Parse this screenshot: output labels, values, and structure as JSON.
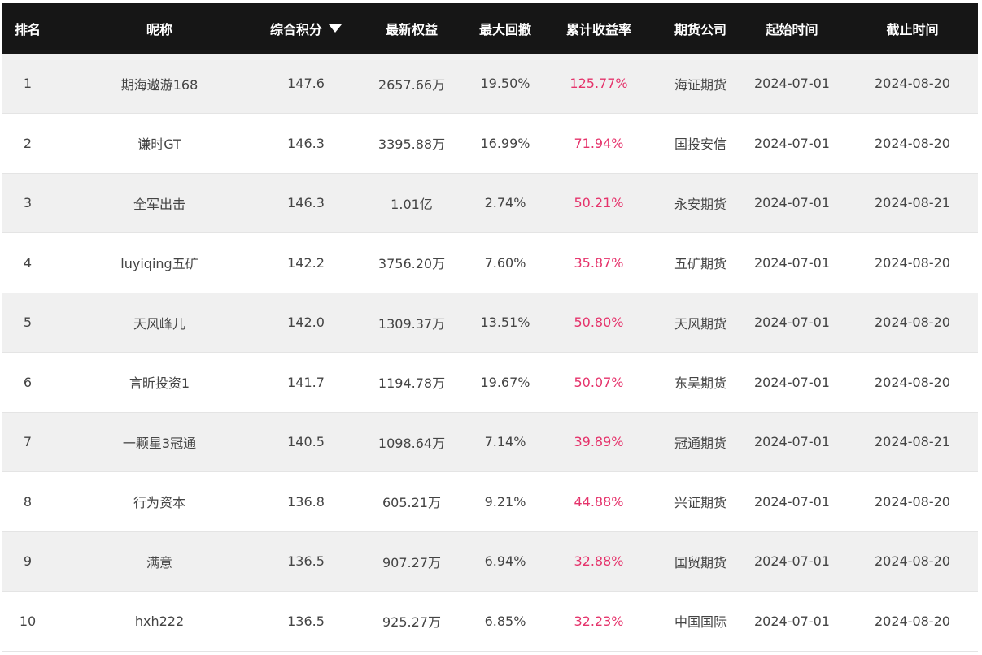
{
  "colors": {
    "header_bg": "#161616",
    "header_text": "#ffffff",
    "yield_text": "#e5336b",
    "row_alt": "#f0f0f0"
  },
  "headers": {
    "rank": "排名",
    "nickname": "昵称",
    "score": "综合积分",
    "equity": "最新权益",
    "drawdown": "最大回撤",
    "yield": "累计收益率",
    "company": "期货公司",
    "start": "起始时间",
    "end": "截止时间"
  },
  "sort": {
    "column": "score",
    "direction": "desc",
    "icon": "triangle-down-icon"
  },
  "rows": [
    {
      "rank": "1",
      "nickname": "期海遨游168",
      "score": "147.6",
      "equity": "2657.66万",
      "drawdown": "19.50%",
      "yield": "125.77%",
      "company": "海证期货",
      "start": "2024-07-01",
      "end": "2024-08-20"
    },
    {
      "rank": "2",
      "nickname": "谦时GT",
      "score": "146.3",
      "equity": "3395.88万",
      "drawdown": "16.99%",
      "yield": "71.94%",
      "company": "国投安信",
      "start": "2024-07-01",
      "end": "2024-08-20"
    },
    {
      "rank": "3",
      "nickname": "全军出击",
      "score": "146.3",
      "equity": "1.01亿",
      "drawdown": "2.74%",
      "yield": "50.21%",
      "company": "永安期货",
      "start": "2024-07-01",
      "end": "2024-08-21"
    },
    {
      "rank": "4",
      "nickname": "luyiqing五矿",
      "score": "142.2",
      "equity": "3756.20万",
      "drawdown": "7.60%",
      "yield": "35.87%",
      "company": "五矿期货",
      "start": "2024-07-01",
      "end": "2024-08-20"
    },
    {
      "rank": "5",
      "nickname": "天风峰儿",
      "score": "142.0",
      "equity": "1309.37万",
      "drawdown": "13.51%",
      "yield": "50.80%",
      "company": "天风期货",
      "start": "2024-07-01",
      "end": "2024-08-20"
    },
    {
      "rank": "6",
      "nickname": "言昕投资1",
      "score": "141.7",
      "equity": "1194.78万",
      "drawdown": "19.67%",
      "yield": "50.07%",
      "company": "东吴期货",
      "start": "2024-07-01",
      "end": "2024-08-20"
    },
    {
      "rank": "7",
      "nickname": "一颗星3冠通",
      "score": "140.5",
      "equity": "1098.64万",
      "drawdown": "7.14%",
      "yield": "39.89%",
      "company": "冠通期货",
      "start": "2024-07-01",
      "end": "2024-08-21"
    },
    {
      "rank": "8",
      "nickname": "行为资本",
      "score": "136.8",
      "equity": "605.21万",
      "drawdown": "9.21%",
      "yield": "44.88%",
      "company": "兴证期货",
      "start": "2024-07-01",
      "end": "2024-08-20"
    },
    {
      "rank": "9",
      "nickname": "满意",
      "score": "136.5",
      "equity": "907.27万",
      "drawdown": "6.94%",
      "yield": "32.88%",
      "company": "国贸期货",
      "start": "2024-07-01",
      "end": "2024-08-20"
    },
    {
      "rank": "10",
      "nickname": "hxh222",
      "score": "136.5",
      "equity": "925.27万",
      "drawdown": "6.85%",
      "yield": "32.23%",
      "company": "中国国际",
      "start": "2024-07-01",
      "end": "2024-08-20"
    }
  ]
}
